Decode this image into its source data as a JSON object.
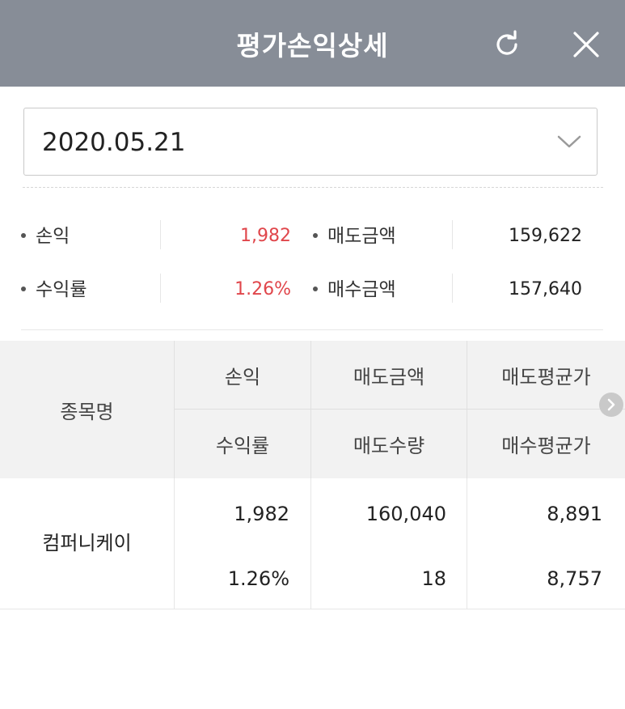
{
  "header": {
    "title": "평가손익상세",
    "refresh_icon": "refresh-icon",
    "close_icon": "close-icon"
  },
  "date_select": {
    "value": "2020.05.21",
    "icon": "chevron-down-icon"
  },
  "summary": {
    "profit_label": "손익",
    "profit_value": "1,982",
    "sell_amount_label": "매도금액",
    "sell_amount_value": "159,622",
    "return_rate_label": "수익률",
    "return_rate_value": "1.26%",
    "buy_amount_label": "매수금액",
    "buy_amount_value": "157,640"
  },
  "table": {
    "headers": {
      "stock_name": "종목명",
      "profit": "손익",
      "sell_amount": "매도금액",
      "sell_avg_price": "매도평균가",
      "return_rate": "수익률",
      "sell_quantity": "매도수량",
      "buy_avg_price": "매수평균가"
    },
    "rows": [
      {
        "stock_name": "컴퍼니케이",
        "profit": "1,982",
        "sell_amount": "160,040",
        "sell_avg_price": "8,891",
        "return_rate": "1.26%",
        "sell_quantity": "18",
        "buy_avg_price": "8,757"
      }
    ]
  },
  "colors": {
    "header_bg": "#878d97",
    "positive_red": "#e0464b",
    "table_header_bg": "#f2f2f2"
  }
}
